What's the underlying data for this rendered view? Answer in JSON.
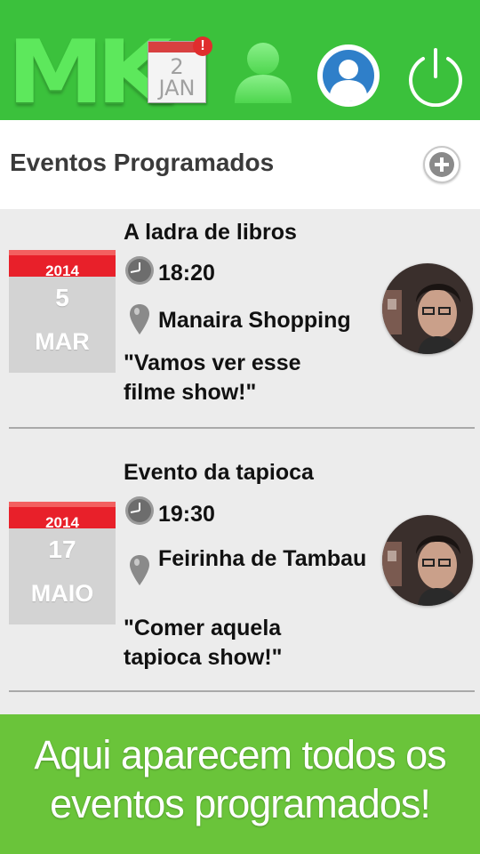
{
  "topbar": {
    "logo_text": "MK",
    "calendar_icon": {
      "icon": "calendar-icon",
      "day": "2",
      "month": "JAN",
      "badge": "!"
    },
    "icons": [
      "user-icon",
      "profile-icon",
      "power-icon"
    ]
  },
  "header": {
    "title": "Eventos Programados",
    "add_icon": "plus-circle-icon"
  },
  "events": [
    {
      "title": "A ladra de libros",
      "year": "2014",
      "day": "5",
      "month": "MAR",
      "time": "18:20",
      "place": "Manaira Shopping",
      "note": "\"Vamos ver esse filme show!\""
    },
    {
      "title": "Evento da tapioca",
      "year": "2014",
      "day": "17",
      "month": "MAIO",
      "time": "19:30",
      "place": "Feirinha de Tambau",
      "note": "\"Comer aquela tapioca show!\""
    }
  ],
  "banner": {
    "text": "Aqui aparecem todos os eventos programados!"
  },
  "colors": {
    "topbar": "#3bc13c",
    "banner": "#6ac43a",
    "date_header": "#e8202a"
  }
}
